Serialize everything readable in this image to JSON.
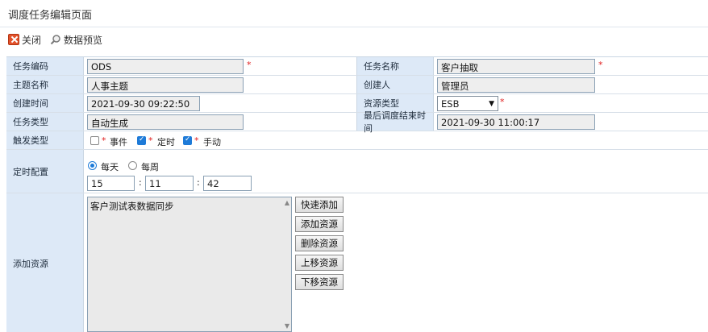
{
  "page": {
    "title": "调度任务编辑页面"
  },
  "toolbar": {
    "close_label": "关闭",
    "preview_label": "数据预览"
  },
  "form": {
    "task_code": {
      "label": "任务编码",
      "value": "ODS"
    },
    "task_name": {
      "label": "任务名称",
      "value": "客户抽取"
    },
    "topic_name": {
      "label": "主题名称",
      "value": "人事主题"
    },
    "creator": {
      "label": "创建人",
      "value": "管理员"
    },
    "create_time": {
      "label": "创建时间",
      "value": "2021-09-30 09:22:50"
    },
    "resource_type": {
      "label": "资源类型",
      "value": "ESB"
    },
    "task_type": {
      "label": "任务类型",
      "value": "自动生成"
    },
    "last_end_time": {
      "label": "最后调度结束时间",
      "value": "2021-09-30 11:00:17"
    },
    "trigger": {
      "label": "触发类型",
      "options": [
        {
          "label": "事件",
          "checked": false
        },
        {
          "label": "定时",
          "checked": true
        },
        {
          "label": "手动",
          "checked": true
        }
      ]
    },
    "schedule": {
      "label": "定时配置",
      "options": [
        {
          "label": "每天",
          "selected": true
        },
        {
          "label": "每周",
          "selected": false
        }
      ],
      "hour": "15",
      "minute": "11",
      "second": "42"
    },
    "resources": {
      "label": "添加资源",
      "items": [
        "客户测试表数据同步"
      ],
      "buttons": [
        "快速添加",
        "添加资源",
        "删除资源",
        "上移资源",
        "下移资源"
      ]
    }
  },
  "required_mark": "*"
}
